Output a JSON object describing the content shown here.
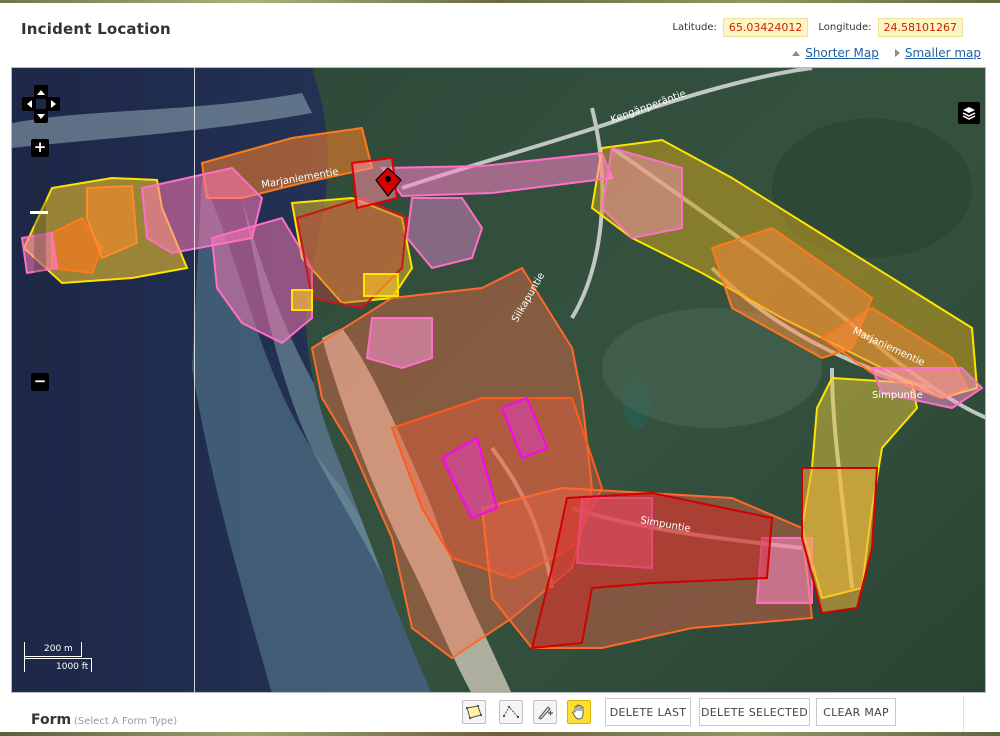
{
  "header": {
    "title": "Incident Location",
    "latitude_label": "Latitude:",
    "latitude_value": "65.03424012",
    "longitude_label": "Longitude:",
    "longitude_value": "24.58101267"
  },
  "map_links": {
    "shorter": "Shorter Map",
    "smaller": "Smaller map"
  },
  "map": {
    "road_labels": [
      "Kengänperäntie",
      "Marjaniementie",
      "Siikapuntie",
      "Simpuntie",
      "Simpuntie",
      "Marjaniementie"
    ],
    "zoom_in": "+",
    "zoom_out": "−",
    "scale_metric": "200 m",
    "scale_imperial": "1000 ft",
    "colors": {
      "yellow": "#ffee00",
      "orange": "#ff7a1a",
      "pink": "#ff6ec7",
      "red": "#e00000",
      "magenta": "#ff00ff"
    }
  },
  "form": {
    "title": "Form",
    "subtitle": "(Select A Form Type)"
  },
  "toolbar": {
    "tools": [
      "draw-polygon-icon",
      "draw-line-icon",
      "edit-vertex-icon",
      "hand-pan-icon"
    ],
    "delete_last": "DELETE LAST",
    "delete_selected": "DELETE SELECTED",
    "clear_map": "CLEAR MAP"
  }
}
